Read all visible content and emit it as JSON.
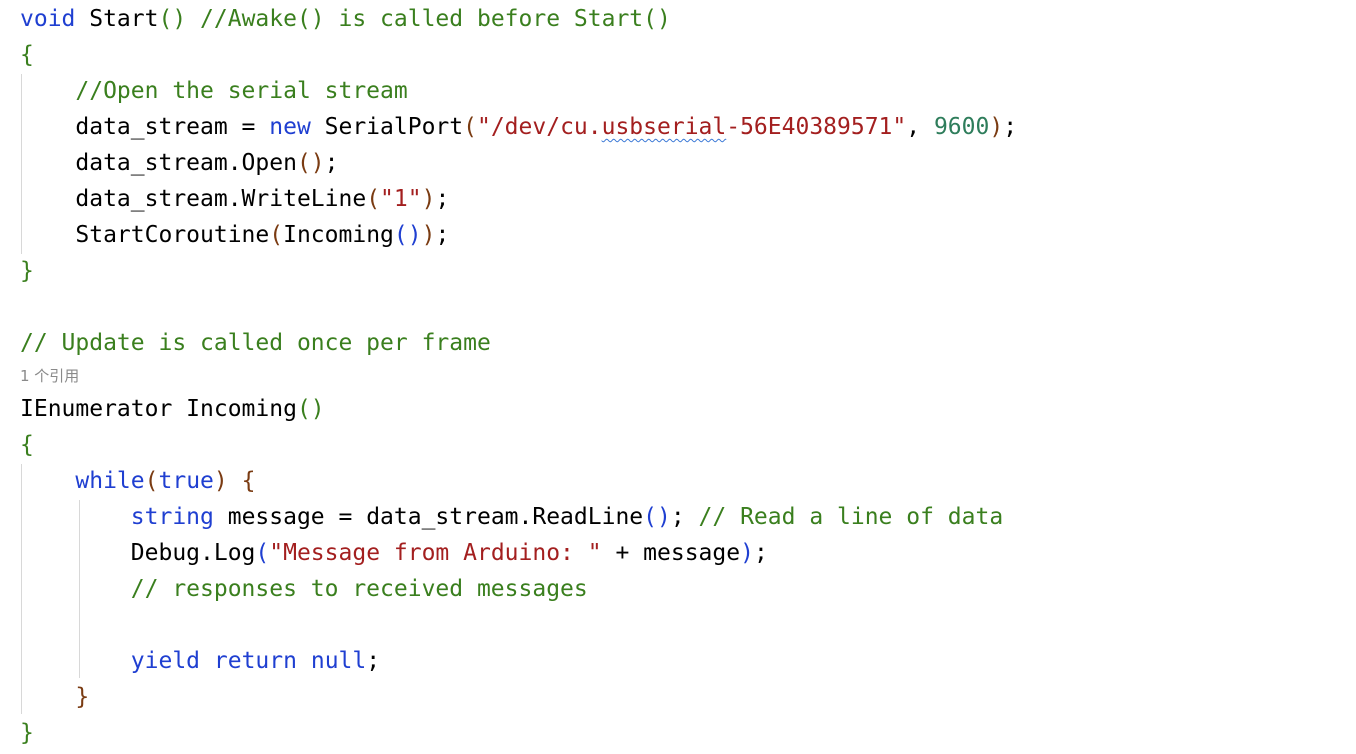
{
  "colors": {
    "keyword": "#1f3fd1",
    "comment": "#3a7f1e",
    "string": "#a31f1f",
    "number": "#2e7d5b",
    "paren_outer": "#b8860b",
    "paren_mid": "#7a3b12",
    "paren_inner": "#1f3fd1",
    "plain": "#000000",
    "codelens": "#8a8a8a",
    "squiggle": "#3a78d6"
  },
  "codelens": "1 个引用",
  "lines": [
    [
      {
        "t": "void",
        "c": "keyword"
      },
      {
        "t": " Start",
        "c": "plain"
      },
      {
        "t": "()",
        "c": "comment_paren"
      },
      {
        "t": " //Awake() is called before Start()",
        "c": "comment"
      }
    ],
    [
      {
        "t": "{",
        "c": "comment"
      }
    ],
    [
      {
        "t": "    //Open the serial stream",
        "c": "comment"
      }
    ],
    [
      {
        "t": "    data_stream = ",
        "c": "plain"
      },
      {
        "t": "new",
        "c": "keyword"
      },
      {
        "t": " SerialPort",
        "c": "plain"
      },
      {
        "t": "(",
        "c": "paren_mid"
      },
      {
        "t": "\"/dev/cu.",
        "c": "string"
      },
      {
        "t": "usbserial",
        "c": "string_squiggle"
      },
      {
        "t": "-56E40389571\"",
        "c": "string"
      },
      {
        "t": ", ",
        "c": "plain"
      },
      {
        "t": "9600",
        "c": "number"
      },
      {
        "t": ")",
        "c": "paren_mid"
      },
      {
        "t": ";",
        "c": "plain"
      }
    ],
    [
      {
        "t": "    data_stream.Open",
        "c": "plain"
      },
      {
        "t": "()",
        "c": "paren_mid"
      },
      {
        "t": ";",
        "c": "plain"
      }
    ],
    [
      {
        "t": "    data_stream.WriteLine",
        "c": "plain"
      },
      {
        "t": "(",
        "c": "paren_mid"
      },
      {
        "t": "\"1\"",
        "c": "string"
      },
      {
        "t": ")",
        "c": "paren_mid"
      },
      {
        "t": ";",
        "c": "plain"
      }
    ],
    [
      {
        "t": "    StartCoroutine",
        "c": "plain"
      },
      {
        "t": "(",
        "c": "paren_mid"
      },
      {
        "t": "Incoming",
        "c": "plain"
      },
      {
        "t": "()",
        "c": "paren_inner"
      },
      {
        "t": ")",
        "c": "paren_mid"
      },
      {
        "t": ";",
        "c": "plain"
      }
    ],
    [
      {
        "t": "}",
        "c": "comment"
      }
    ],
    [],
    [
      {
        "t": "// Update is called once per frame",
        "c": "comment"
      }
    ],
    [
      {
        "t": "IEnumerator Incoming",
        "c": "plain"
      },
      {
        "t": "()",
        "c": "comment"
      }
    ],
    [
      {
        "t": "{",
        "c": "comment"
      }
    ],
    [
      {
        "t": "    ",
        "c": "plain"
      },
      {
        "t": "while",
        "c": "keyword"
      },
      {
        "t": "(",
        "c": "paren_mid"
      },
      {
        "t": "true",
        "c": "keyword"
      },
      {
        "t": ")",
        "c": "paren_mid"
      },
      {
        "t": " {",
        "c": "paren_mid"
      }
    ],
    [
      {
        "t": "        ",
        "c": "plain"
      },
      {
        "t": "string",
        "c": "keyword"
      },
      {
        "t": " message = data_stream.ReadLine",
        "c": "plain"
      },
      {
        "t": "()",
        "c": "paren_inner"
      },
      {
        "t": "; ",
        "c": "plain"
      },
      {
        "t": "// Read a line of data",
        "c": "comment"
      }
    ],
    [
      {
        "t": "        Debug.Log",
        "c": "plain"
      },
      {
        "t": "(",
        "c": "paren_inner"
      },
      {
        "t": "\"Message from Arduino: \"",
        "c": "string"
      },
      {
        "t": " + message",
        "c": "plain"
      },
      {
        "t": ")",
        "c": "paren_inner"
      },
      {
        "t": ";",
        "c": "plain"
      }
    ],
    [
      {
        "t": "        // responses to received messages",
        "c": "comment"
      }
    ],
    [],
    [
      {
        "t": "        ",
        "c": "plain"
      },
      {
        "t": "yield",
        "c": "keyword"
      },
      {
        "t": " ",
        "c": "plain"
      },
      {
        "t": "return",
        "c": "keyword"
      },
      {
        "t": " ",
        "c": "plain"
      },
      {
        "t": "null",
        "c": "keyword"
      },
      {
        "t": ";",
        "c": "plain"
      }
    ],
    [
      {
        "t": "    }",
        "c": "paren_mid"
      }
    ],
    [
      {
        "t": "}",
        "c": "comment"
      }
    ]
  ]
}
